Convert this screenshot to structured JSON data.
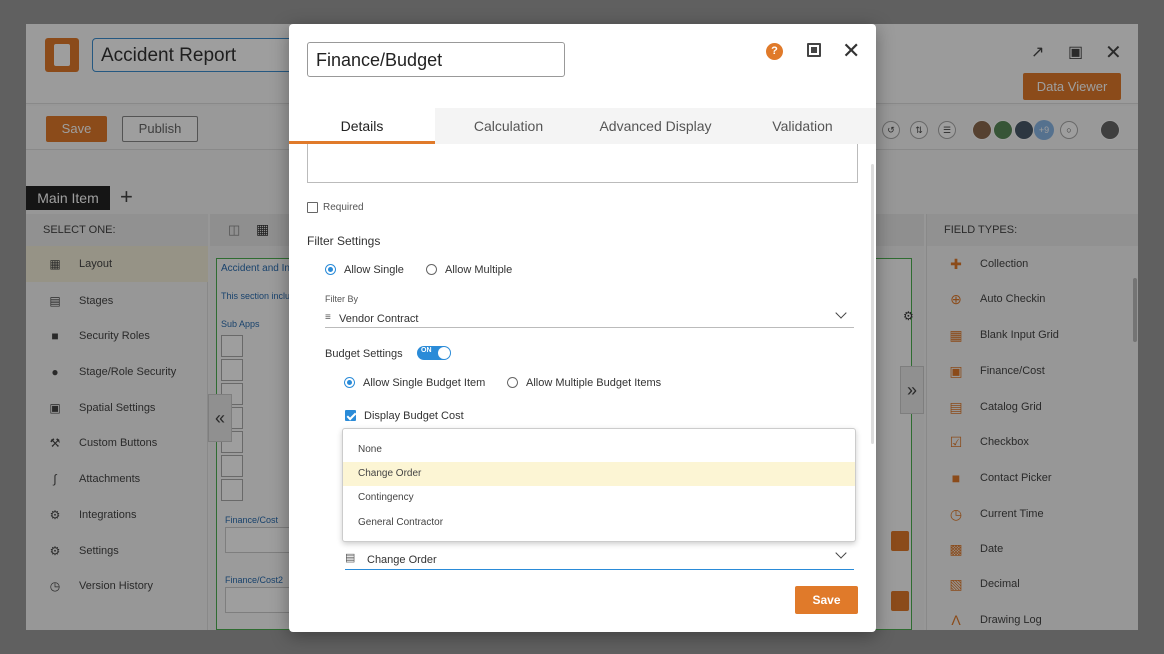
{
  "app": {
    "title": "Accident Report",
    "data_viewer_label": "Data Viewer",
    "save_label": "Save",
    "publish_label": "Publish",
    "avatar_more": "+9",
    "main_tab_label": "Main Item",
    "add_tab_label": "+"
  },
  "left_panel": {
    "header": "SELECT ONE:",
    "items": [
      {
        "label": "Layout",
        "icon": "layout-icon"
      },
      {
        "label": "Stages",
        "icon": "stages-icon"
      },
      {
        "label": "Security Roles",
        "icon": "lock-icon"
      },
      {
        "label": "Stage/Role Security",
        "icon": "user-lock-icon"
      },
      {
        "label": "Spatial Settings",
        "icon": "spatial-icon"
      },
      {
        "label": "Custom Buttons",
        "icon": "wrench-icon"
      },
      {
        "label": "Attachments",
        "icon": "paperclip-icon"
      },
      {
        "label": "Integrations",
        "icon": "integrations-icon"
      },
      {
        "label": "Settings",
        "icon": "gears-icon"
      },
      {
        "label": "Version History",
        "icon": "history-icon"
      }
    ]
  },
  "canvas": {
    "section_title": "Accident and In",
    "section_note": "This section inclu",
    "sub_apps": "Sub Apps",
    "finance_cost": "Finance/Cost",
    "finance_cost2": "Finance/Cost2"
  },
  "right_panel": {
    "header": "FIELD TYPES:",
    "items": [
      {
        "label": "Collection",
        "icon": "plus-icon"
      },
      {
        "label": "Auto Checkin",
        "icon": "crosshair-icon"
      },
      {
        "label": "Blank Input Grid",
        "icon": "grid-icon"
      },
      {
        "label": "Finance/Cost",
        "icon": "dollar-doc-icon"
      },
      {
        "label": "Catalog Grid",
        "icon": "catalog-icon"
      },
      {
        "label": "Checkbox",
        "icon": "checkbox-icon"
      },
      {
        "label": "Contact Picker",
        "icon": "contact-icon"
      },
      {
        "label": "Current Time",
        "icon": "clock-icon"
      },
      {
        "label": "Date",
        "icon": "calendar-icon"
      },
      {
        "label": "Decimal",
        "icon": "decimal-icon"
      },
      {
        "label": "Drawing Log",
        "icon": "compass-icon"
      }
    ]
  },
  "modal": {
    "title_value": "Finance/Budget",
    "help_label": "?",
    "tabs": [
      {
        "label": "Details",
        "active": true
      },
      {
        "label": "Calculation",
        "active": false
      },
      {
        "label": "Advanced Display",
        "active": false
      },
      {
        "label": "Validation",
        "active": false
      }
    ],
    "required_label": "Required",
    "filter_settings_title": "Filter Settings",
    "allow_single_label": "Allow Single",
    "allow_multiple_label": "Allow Multiple",
    "filter_by_label": "Filter By",
    "filter_by_value": "Vendor Contract",
    "budget_settings_label": "Budget Settings",
    "toggle_label": "ON",
    "allow_single_budget_label": "Allow Single Budget Item",
    "allow_multiple_budget_label": "Allow Multiple Budget Items",
    "display_budget_cost_label": "Display Budget Cost",
    "dropdown_options": [
      "None",
      "Change Order",
      "Contingency",
      "General Contractor"
    ],
    "dropdown_highlighted": "Change Order",
    "selected_value": "Change Order",
    "save_label": "Save"
  },
  "colors": {
    "accent": "#e07a2a",
    "primary_blue": "#2a8bd8",
    "highlight": "#fcf5d4"
  }
}
